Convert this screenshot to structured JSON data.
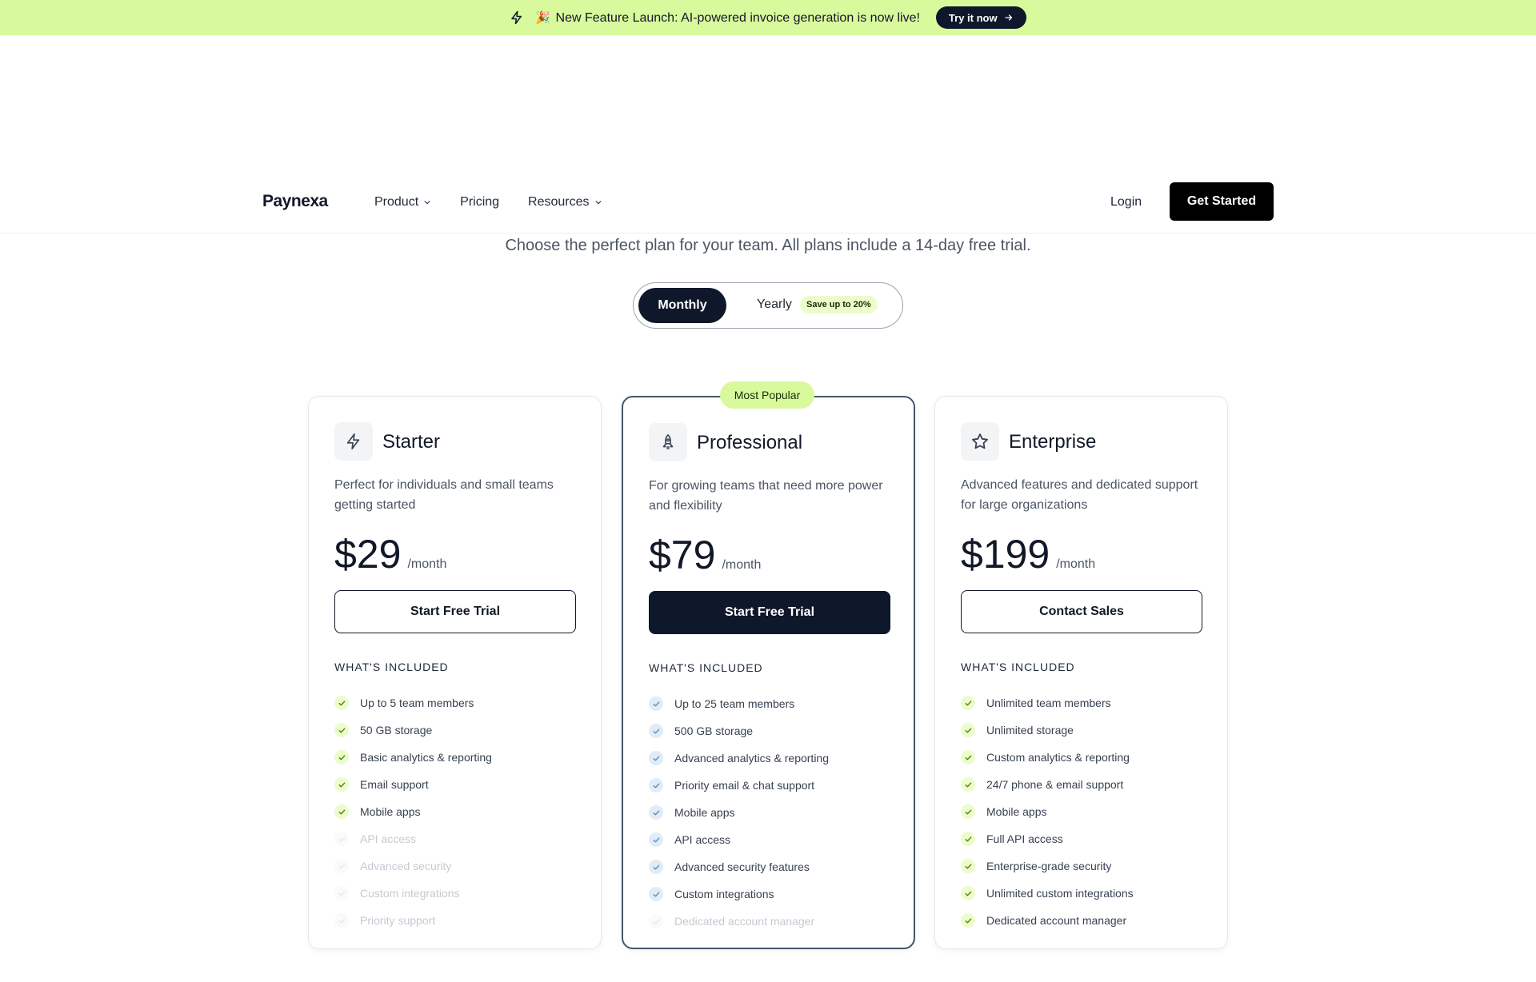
{
  "banner": {
    "emoji": "🎉",
    "text": "New Feature Launch: AI-powered invoice generation is now live!",
    "cta": "Try it now"
  },
  "nav": {
    "logo": "Paynexa",
    "links": [
      "Product",
      "Pricing",
      "Resources"
    ],
    "login": "Login",
    "cta": "Get Started"
  },
  "pricing": {
    "subtitle": "Choose the perfect plan for your team. All plans include a 14-day free trial.",
    "toggle": {
      "monthly": "Monthly",
      "yearly": "Yearly",
      "save_badge": "Save up to 20%",
      "selected": "Monthly"
    },
    "popular_badge": "Most Popular",
    "included_label": "WHAT'S INCLUDED",
    "plans": [
      {
        "name": "Starter",
        "icon": "lightning-icon",
        "description": "Perfect for individuals and small teams getting started",
        "price": "$29",
        "period": "/month",
        "button": "Start Free Trial",
        "features": [
          {
            "text": "Up to 5 team members",
            "included": true
          },
          {
            "text": "50 GB storage",
            "included": true
          },
          {
            "text": "Basic analytics & reporting",
            "included": true
          },
          {
            "text": "Email support",
            "included": true
          },
          {
            "text": "Mobile apps",
            "included": true
          },
          {
            "text": "API access",
            "included": false
          },
          {
            "text": "Advanced security",
            "included": false
          },
          {
            "text": "Custom integrations",
            "included": false
          },
          {
            "text": "Priority support",
            "included": false
          }
        ]
      },
      {
        "name": "Professional",
        "icon": "rocket-icon",
        "description": "For growing teams that need more power and flexibility",
        "price": "$79",
        "period": "/month",
        "button": "Start Free Trial",
        "features": [
          {
            "text": "Up to 25 team members",
            "included": true
          },
          {
            "text": "500 GB storage",
            "included": true
          },
          {
            "text": "Advanced analytics & reporting",
            "included": true
          },
          {
            "text": "Priority email & chat support",
            "included": true
          },
          {
            "text": "Mobile apps",
            "included": true
          },
          {
            "text": "API access",
            "included": true
          },
          {
            "text": "Advanced security features",
            "included": true
          },
          {
            "text": "Custom integrations",
            "included": true
          },
          {
            "text": "Dedicated account manager",
            "included": false
          }
        ]
      },
      {
        "name": "Enterprise",
        "icon": "star-icon",
        "description": "Advanced features and dedicated support for large organizations",
        "price": "$199",
        "period": "/month",
        "button": "Contact Sales",
        "features": [
          {
            "text": "Unlimited team members",
            "included": true
          },
          {
            "text": "Unlimited storage",
            "included": true
          },
          {
            "text": "Custom analytics & reporting",
            "included": true
          },
          {
            "text": "24/7 phone & email support",
            "included": true
          },
          {
            "text": "Mobile apps",
            "included": true
          },
          {
            "text": "Full API access",
            "included": true
          },
          {
            "text": "Enterprise-grade security",
            "included": true
          },
          {
            "text": "Unlimited custom integrations",
            "included": true
          },
          {
            "text": "Dedicated account manager",
            "included": true
          }
        ]
      }
    ]
  },
  "colors": {
    "banner_bg": "#d9f99d",
    "dark": "#0f172a",
    "accent_check_bg": "#ecfccb",
    "featured_check_bg": "#e0ecf7"
  }
}
